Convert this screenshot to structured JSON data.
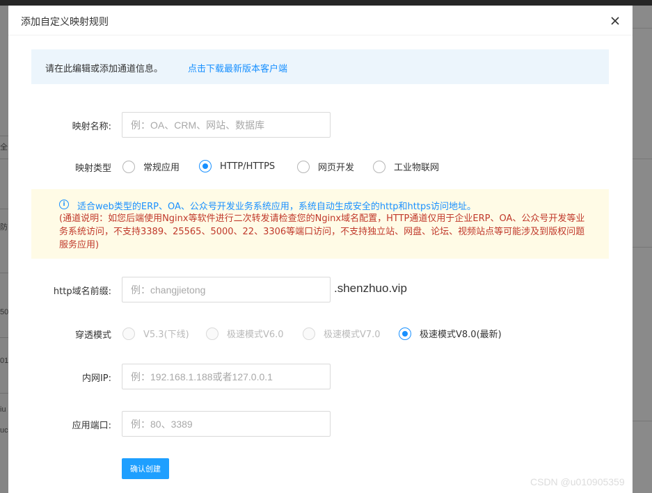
{
  "backdrop": {
    "fragments": [
      "全",
      "防",
      "50",
      "01",
      "iu",
      "uc"
    ]
  },
  "dialog": {
    "title": "添加自定义映射规则",
    "close_icon": "close-icon"
  },
  "banner": {
    "text": "请在此编辑或添加通道信息。",
    "link": "点击下载最新版本客户端"
  },
  "form": {
    "name": {
      "label": "映射名称:",
      "placeholder": "例：OA、CRM、网站、数据库"
    },
    "type": {
      "label": "映射类型",
      "options": [
        "常规应用",
        "HTTP/HTTPS",
        "网页开发",
        "工业物联网"
      ],
      "selected": "HTTP/HTTPS"
    },
    "notice": {
      "icon": "info-icon",
      "main": "适合web类型的ERP、OA、公众号开发业务系统应用，系统自动生成安全的http和https访问地址。",
      "detail": "(通道说明：如您后端使用Nginx等软件进行二次转发请检查您的Nginx域名配置，HTTP通道仅用于企业ERP、OA、公众号开发等业务系统访问，不支持3389、25565、5000、22、3306等端口访问，不支持独立站、网盘、论坛、视频站点等可能涉及到版权问题服务应用)"
    },
    "domain": {
      "label": "http域名前缀:",
      "placeholder": "例：changjietong",
      "suffix": ".shenzhuo.vip"
    },
    "mode": {
      "label": "穿透模式",
      "options": [
        "V5.3(下线)",
        "极速模式V6.0",
        "极速模式V7.0",
        "极速模式V8.0(最新)"
      ],
      "selected": "极速模式V8.0(最新)"
    },
    "ip": {
      "label": "内网IP:",
      "placeholder": "例：192.168.1.188或者127.0.0.1"
    },
    "port": {
      "label": "应用端口:",
      "placeholder": "例：80、3389"
    },
    "submit": "确认创建"
  },
  "watermark": "CSDN @u010905359",
  "colors": {
    "accent": "#1890ff",
    "button": "#1e9fff",
    "warn_text": "#c0392b",
    "warn_bg": "#fffbe6",
    "banner_bg": "#ecf5fc"
  }
}
